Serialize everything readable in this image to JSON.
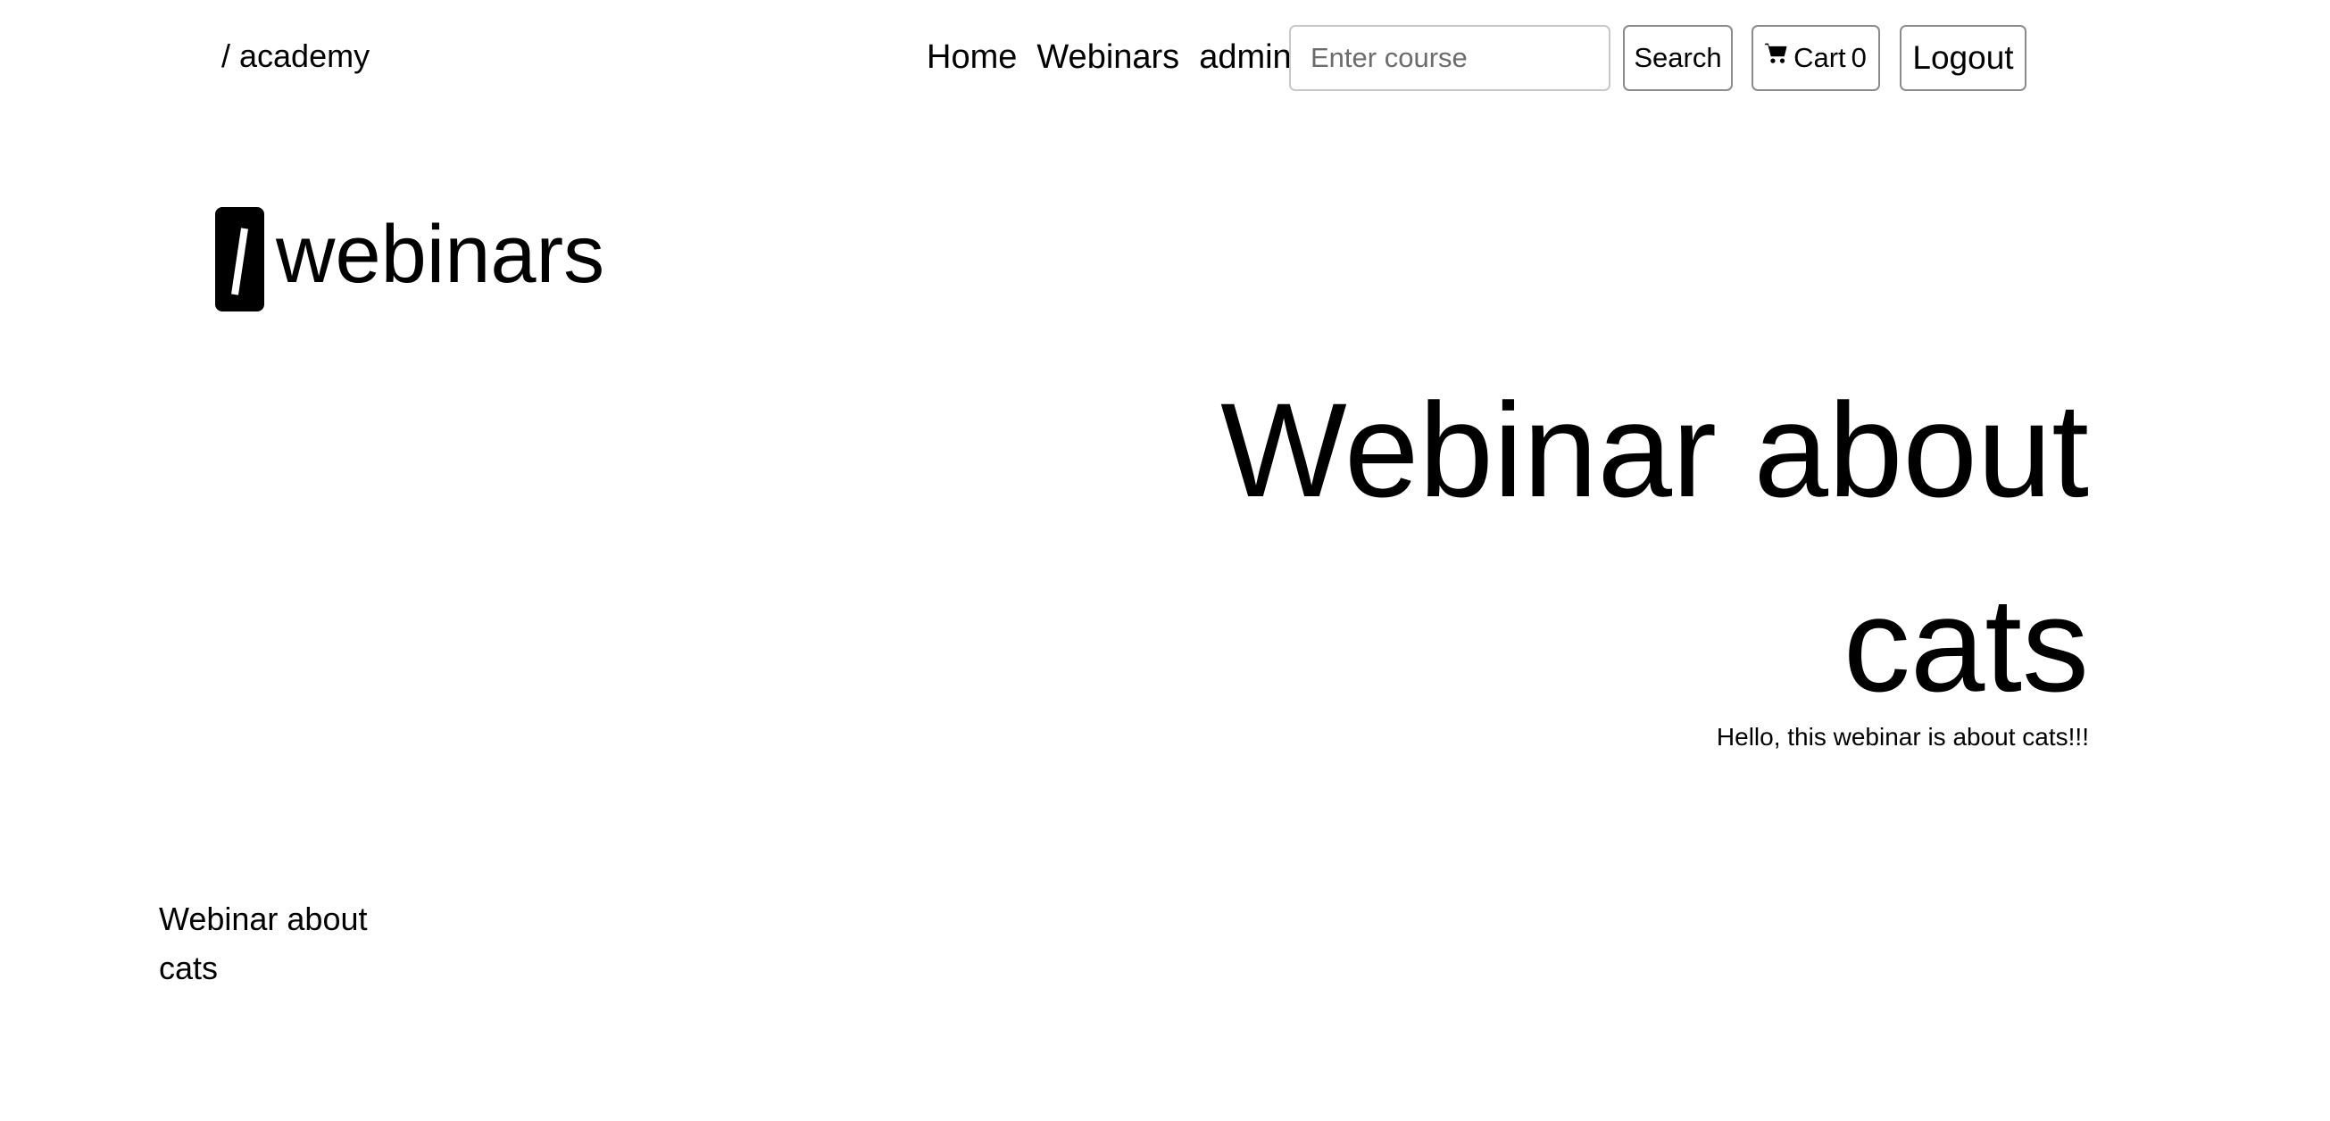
{
  "navbar": {
    "brand": "/ academy",
    "links": [
      {
        "label": "Home"
      },
      {
        "label": "Webinars"
      },
      {
        "label": "admin"
      }
    ],
    "search": {
      "placeholder": "Enter course",
      "value": "",
      "button_label": "Search"
    },
    "cart": {
      "label": "Cart",
      "count": "0",
      "icon": "cart-icon"
    },
    "logout_label": "Logout"
  },
  "logo": {
    "mark": "/",
    "text": "webinars"
  },
  "hero": {
    "title": "Webinar about cats",
    "description": "Hello, this webinar is about cats!!!"
  },
  "course_card": {
    "title": "Webinar about cats"
  }
}
